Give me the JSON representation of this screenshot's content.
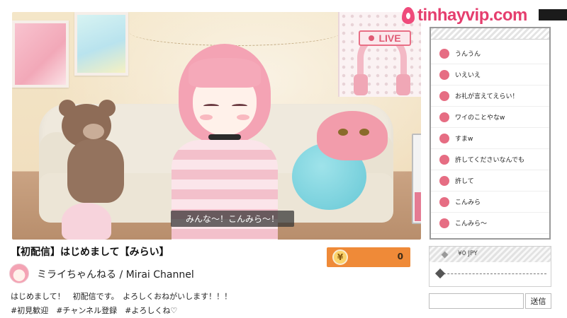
{
  "brand": {
    "text": "tinhayvip.com",
    "tag": ""
  },
  "player": {
    "live_label": "LIVE",
    "subtitle": "みんな～！こんみら～！",
    "meter_level": 0.36
  },
  "stream": {
    "title": "【初配信】はじめまして【みらい】",
    "channel_name": "ミライちゃんねる / Mirai Channel",
    "description_line1": "はじめまして！　初配信です。　よろしくおねがいします！！！",
    "description_line2": "#初見歓迎　#チャンネル登録　#よろしくね♡"
  },
  "coins": {
    "symbol": "¥",
    "value": "0"
  },
  "chat": {
    "messages": [
      "うんうん",
      "いえいえ",
      "お礼が言えてえらい！",
      "ワイのことやなw",
      "すまw",
      "許してくださいなんでも",
      "許して",
      "こんみら",
      "こんみら～"
    ]
  },
  "superchat": {
    "amount_label": "¥0 JPY",
    "slider_value": 0
  },
  "input": {
    "placeholder": "",
    "send_label": "送信"
  },
  "colors": {
    "accent": "#e05a74",
    "coin": "#ef8a38",
    "chat_avatar": "#e66d83",
    "brand": "#e53e6e"
  }
}
